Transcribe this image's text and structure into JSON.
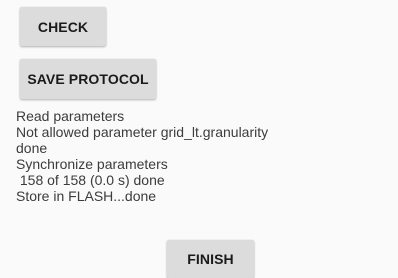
{
  "buttons": {
    "check_label": "CHECK",
    "save_protocol_label": "SAVE PROTOCOL",
    "finish_label": "FINISH"
  },
  "log": {
    "lines": [
      "Read parameters",
      "Not allowed parameter grid_lt.granularity",
      "done",
      "Synchronize parameters",
      " 158 of 158 (0.0 s) done",
      "Store in FLASH...done"
    ]
  },
  "colors": {
    "background": "#fafafa",
    "button_background": "#dcdcdc",
    "button_text": "#1a1a1a",
    "log_text": "#3c3c3c"
  }
}
